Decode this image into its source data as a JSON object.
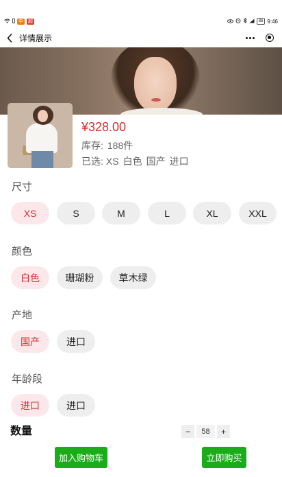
{
  "status_bar": {
    "left_icons": [
      "wifi-icon",
      "sim-icon"
    ],
    "left_badges": [
      "中",
      "超"
    ],
    "right_icons": [
      "eye-icon",
      "alarm-icon",
      "bluetooth-icon",
      "signal-icon"
    ],
    "battery": "86",
    "time": "9:46"
  },
  "nav": {
    "title": "详情展示",
    "back_icon": "back-arrow-icon",
    "more_icon": "more-dots-icon",
    "target_icon": "record-target-icon"
  },
  "product": {
    "price": "¥328.00",
    "stock_label": "库存:",
    "stock_value": "188件",
    "selected_label": "已选:",
    "selected_values": [
      "XS",
      "白色",
      "国产",
      "进口"
    ]
  },
  "options": {
    "size": {
      "title": "尺寸",
      "items": [
        "XS",
        "S",
        "M",
        "L",
        "XL",
        "XXL"
      ],
      "selected": "XS"
    },
    "color": {
      "title": "颜色",
      "items": [
        "白色",
        "珊瑚粉",
        "草木绿"
      ],
      "selected": "白色"
    },
    "origin": {
      "title": "产地",
      "items": [
        "国产",
        "进口"
      ],
      "selected": "国产"
    },
    "age": {
      "title": "年龄段",
      "items": [
        "进口",
        "进口"
      ],
      "selected_index": 0
    }
  },
  "quantity": {
    "label": "数量",
    "minus": "−",
    "value": "58",
    "plus": "+"
  },
  "actions": {
    "add_to_cart": "加入购物车",
    "buy_now": "立即购买"
  },
  "colors": {
    "accent_red": "#d32f2f",
    "selected_chip_bg": "#fce8ea",
    "chip_bg": "#eeeeee",
    "button_green": "#1aad19"
  }
}
